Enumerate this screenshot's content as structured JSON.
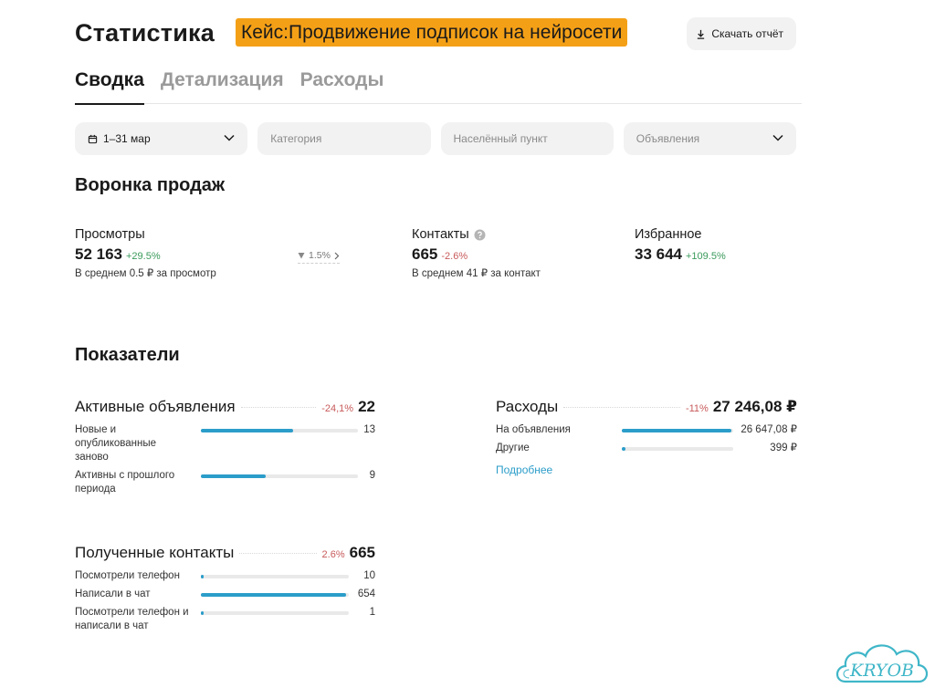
{
  "header": {
    "title": "Статистика",
    "case_badge": "Кейс:Продвижение подписок на нейросети",
    "download_label": "Скачать отчёт"
  },
  "tabs": [
    {
      "label": "Сводка",
      "active": true
    },
    {
      "label": "Детализация",
      "active": false
    },
    {
      "label": "Расходы",
      "active": false
    }
  ],
  "filters": {
    "date": "1–31 мар",
    "category_placeholder": "Категория",
    "city_placeholder": "Населённый пункт",
    "ads_placeholder": "Объявления"
  },
  "funnel": {
    "title": "Воронка продаж",
    "views": {
      "label": "Просмотры",
      "value": "52 163",
      "delta": "+29.5%",
      "note": "В среднем 0.5 ₽ за просмотр",
      "side_delta": "1.5%"
    },
    "contacts": {
      "label": "Контакты",
      "value": "665",
      "delta": "-2.6%",
      "note": "В среднем 41 ₽ за контакт"
    },
    "favorites": {
      "label": "Избранное",
      "value": "33 644",
      "delta": "+109.5%"
    }
  },
  "kpi": {
    "title": "Показатели",
    "active_ads": {
      "title": "Активные объявления",
      "delta": "-24,1%",
      "value": "22",
      "rows": [
        {
          "label": "Новые и опубликованные заново",
          "value": "13",
          "share": 0.59
        },
        {
          "label": "Активны с прошлого периода",
          "value": "9",
          "share": 0.41
        }
      ]
    },
    "expenses": {
      "title": "Расходы",
      "delta": "-11%",
      "value": "27 246,08 ₽",
      "rows": [
        {
          "label": "На объявления",
          "value": "26 647,08 ₽",
          "share": 0.98
        },
        {
          "label": "Другие",
          "value": "399 ₽",
          "share": 0.03
        }
      ],
      "more_label": "Подробнее"
    },
    "contacts": {
      "title": "Полученные контакты",
      "delta": "2.6%",
      "value": "665",
      "rows": [
        {
          "label": "Посмотрели телефон",
          "value": "10",
          "share": 0.02
        },
        {
          "label": "Написали в чат",
          "value": "654",
          "share": 0.98
        },
        {
          "label": "Посмотрели телефон и написали в чат",
          "value": "1",
          "share": 0.01
        }
      ]
    }
  },
  "watermark": "KRYOB",
  "colors": {
    "accent_bar": "#2b9dc9",
    "badge": "#f4a017",
    "positive": "#3a9a5b",
    "negative": "#c85a5a"
  }
}
